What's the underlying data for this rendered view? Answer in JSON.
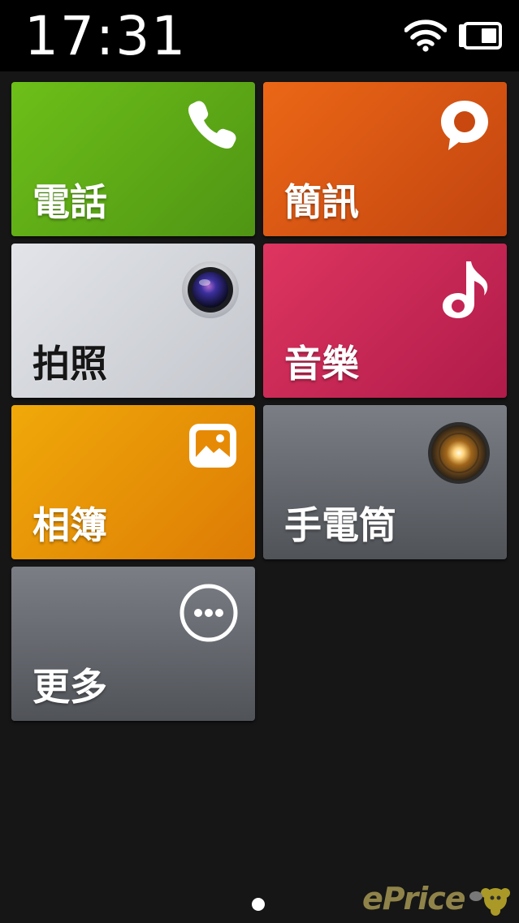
{
  "status_bar": {
    "time": "17:31",
    "icons": [
      "wifi-icon",
      "battery-icon"
    ]
  },
  "tiles": [
    {
      "label": "電話",
      "icon": "phone-icon",
      "color": "#5ea816"
    },
    {
      "label": "簡訊",
      "icon": "message-bubble-icon",
      "color": "#d75513"
    },
    {
      "label": "拍照",
      "icon": "camera-lens-icon",
      "color": "#d3d5da"
    },
    {
      "label": "音樂",
      "icon": "music-note-icon",
      "color": "#c72855"
    },
    {
      "label": "相簿",
      "icon": "picture-icon",
      "color": "#e79207"
    },
    {
      "label": "手電筒",
      "icon": "flashlight-icon",
      "color": "#65686e"
    },
    {
      "label": "更多",
      "icon": "more-dots-icon",
      "color": "#65686e"
    }
  ],
  "page_indicator": {
    "pages": 1,
    "current": 1
  },
  "watermark": "ePrice"
}
